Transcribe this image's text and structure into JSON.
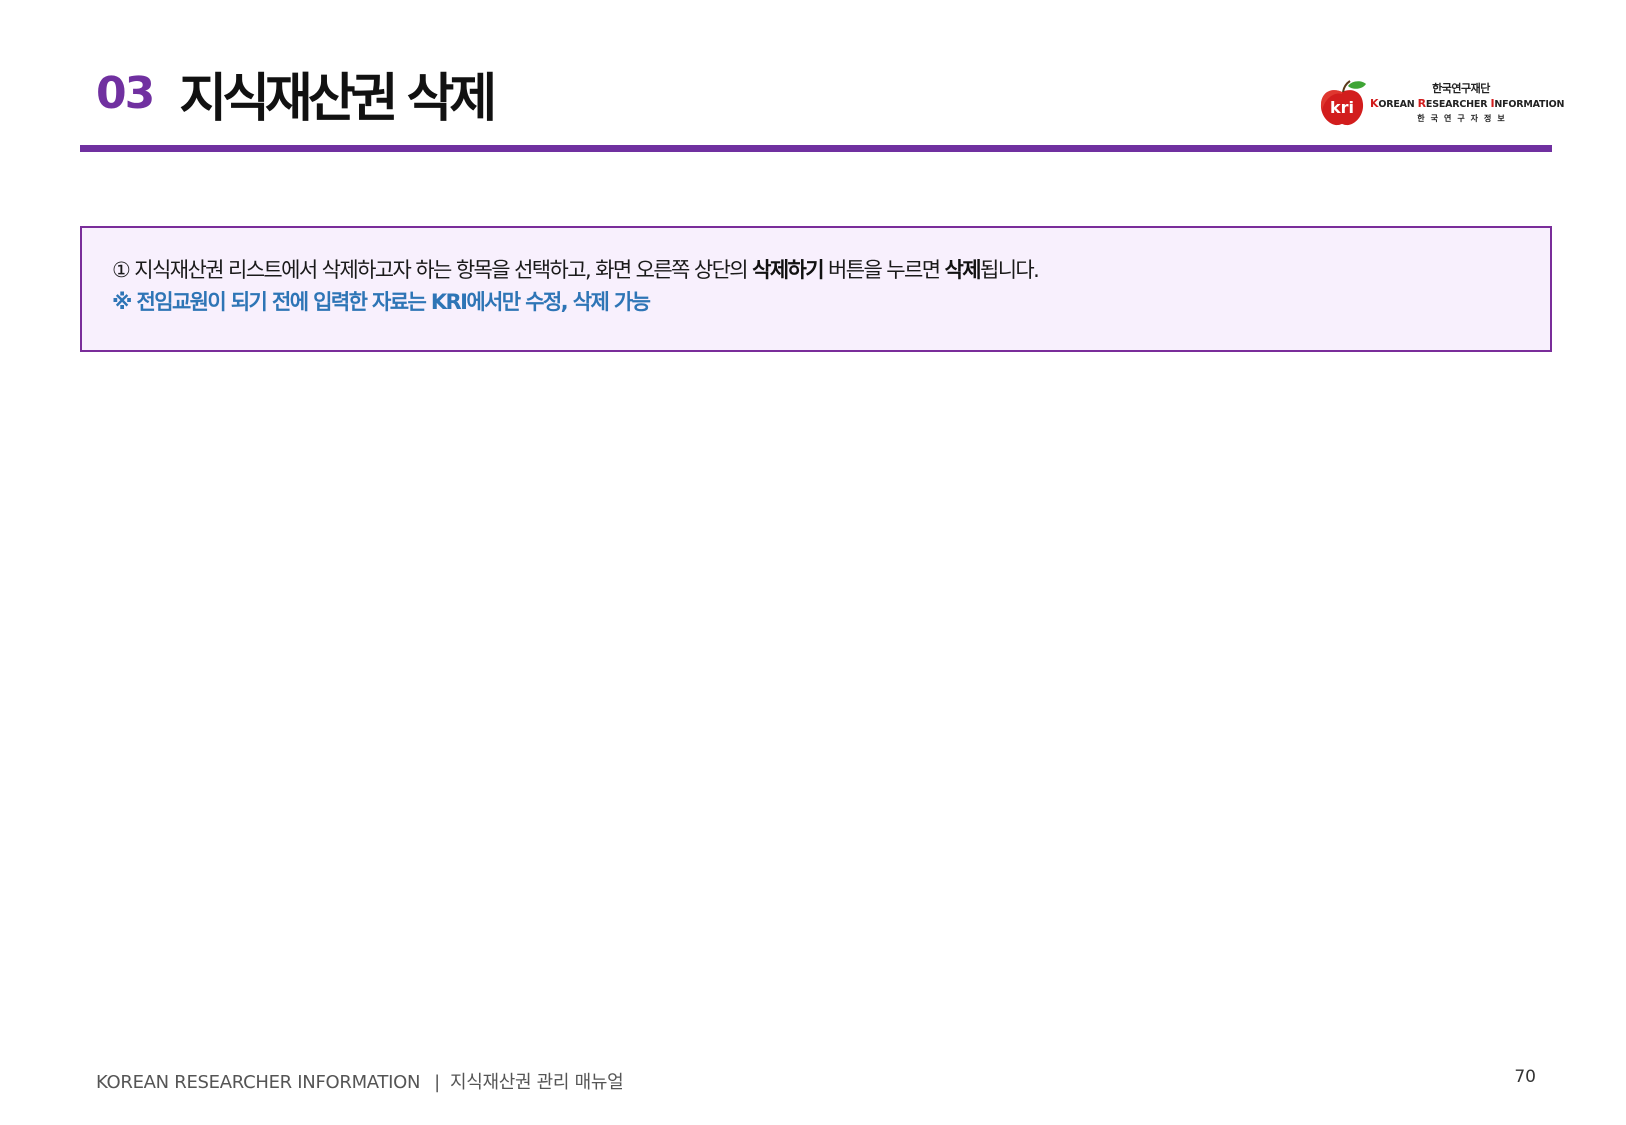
{
  "header": {
    "section_number": "03",
    "title": "지식재산권 삭제"
  },
  "logo": {
    "mark": "kri",
    "org_name_ko": "한국연구재단",
    "product_name_en": {
      "k": "K",
      "orean": "OREAN ",
      "r": "R",
      "esearcher": "ESEARCHER ",
      "i": "I",
      "nformation": "NFORMATION"
    },
    "product_name_ko": "한국연구자정보"
  },
  "instructions": {
    "line1": {
      "part1": "① 지식재산권 리스트에서 삭제하고자 하는 항목을 선택하고, 화면 오른쪽 상단의 ",
      "bold1": "삭제하기",
      "part2": " 버튼을 누르면 ",
      "bold2": "삭제",
      "part3": "됩니다."
    },
    "note": "※ 전임교원이 되기 전에 입력한 자료는 KRI에서만 수정, 삭제 가능"
  },
  "footer": {
    "brand": "KOREAN RESEARCHER INFORMATION",
    "separator": "|",
    "manual_title": "지식재산권 관리 매뉴얼",
    "page_number": "70"
  },
  "colors": {
    "accent_purple": "#7030a0",
    "box_border": "#7a2d9a",
    "box_background": "#f8f0fd",
    "note_blue": "#2e75b6",
    "logo_red": "#d21d1d",
    "logo_leaf_green": "#3fa535"
  }
}
